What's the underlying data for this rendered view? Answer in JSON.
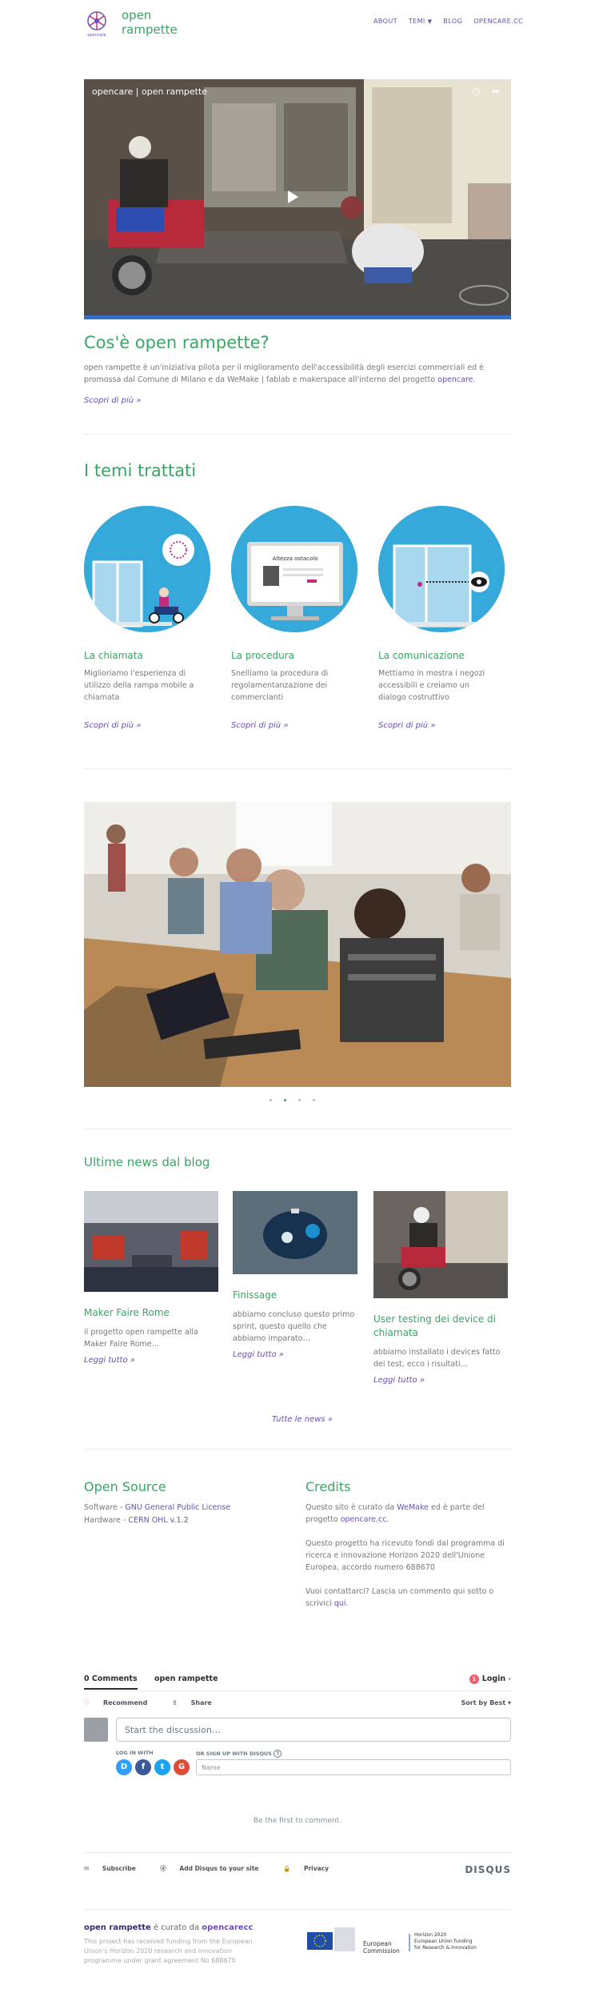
{
  "header": {
    "logo_text": "opencare",
    "brand_line1": "open",
    "brand_line2": "rampette",
    "nav": [
      {
        "label": "ABOUT"
      },
      {
        "label": "TEMI"
      },
      {
        "label": "BLOG"
      },
      {
        "label": "OPENCARE.CC"
      }
    ]
  },
  "video": {
    "title": "opencare | open rampette"
  },
  "intro": {
    "title": "Cos'è open rampette?",
    "text": "open rampette è un'iniziativa pilota per il miglioramento dell'accessibilità degli esercizi commerciali ed è promossa dal Comune di Milano e da WeMake | fablab e makerspace all'interno del progetto",
    "link": "opencare",
    "more": "Scopri di più »"
  },
  "themes": {
    "title": "I temi trattati",
    "items": [
      {
        "title": "La chiamata",
        "text": "Miglioriamo l'esperienza di utilizzo della rampa mobile a chiamata",
        "more": "Scopri di più »"
      },
      {
        "title": "La procedura",
        "text": "Snelliamo la procedura di regolamentanzazione dei commercianti",
        "more": "Scopri di più »",
        "screen_title": "Altezza ostacolo"
      },
      {
        "title": "La comunicazione",
        "text": "Mettiamo in mostra i negozi accessibili e creiamo un dialogo costruttivo",
        "more": "Scopri di più »"
      }
    ]
  },
  "carousel": {
    "slides": 4,
    "active": 1
  },
  "blog": {
    "title": "Ultime news dal blog",
    "posts": [
      {
        "title": "Maker Faire Rome",
        "excerpt": "il progetto open rampette alla Maker Faire Rome…",
        "more": "Leggi tutto »"
      },
      {
        "title": "Finissage",
        "excerpt": "abbiamo concluso questo primo sprint, questo quello che abbiamo imparato…",
        "more": "Leggi tutto »"
      },
      {
        "title": "User testing dei device di chiamata",
        "excerpt": "abbiamo installato i devices fatto dei test, ecco i risultati…",
        "more": "Leggi tutto »"
      }
    ],
    "all": "Tutte le news »"
  },
  "opensource": {
    "title": "Open Source",
    "software_label": "Software - ",
    "software_link": "GNU General Public License",
    "hardware_label": "Hardware - ",
    "hardware_link": "CERN OHL v.1.2"
  },
  "credits": {
    "title": "Credits",
    "p1_a": "Questo sito è curato da ",
    "p1_link1": "WeMake",
    "p1_b": " ed è parte del progetto ",
    "p1_link2": "opencare.cc",
    "p1_c": ".",
    "p2": "Questo progetto ha ricevuto fondi dal programma di ricerca e innovazione Horizon 2020 dell'Unione Europea, accordo numero 688670",
    "p3_a": "Vuoi contattarci? Lascia un commento qui sotto o scrivici ",
    "p3_link": "qui",
    "p3_b": "."
  },
  "disqus": {
    "comments_tab": "0 Comments",
    "site_tab": "open rampette",
    "login_count": "1",
    "login": "Login",
    "recommend": "Recommend",
    "share": "Share",
    "sort": "Sort by Best",
    "placeholder": "Start the discussion…",
    "login_with": "LOG IN WITH",
    "signup": "OR SIGN UP WITH DISQUS",
    "name_placeholder": "Name",
    "first": "Be the first to comment.",
    "subscribe": "Subscribe",
    "add": "Add Disqus to your site",
    "privacy": "Privacy",
    "logo": "DISQUS"
  },
  "footer": {
    "title_a": "open rampette",
    "title_b": " è curato da ",
    "title_c": "opencarecc",
    "text": "This project has received funding from the European Union's Horizon 2020 research and innovation programme under grant agreement No 688670",
    "eu_label": "European Commission",
    "h2020_1": "Horizon 2020",
    "h2020_2": "European Union funding",
    "h2020_3": "for Research & Innovation"
  }
}
